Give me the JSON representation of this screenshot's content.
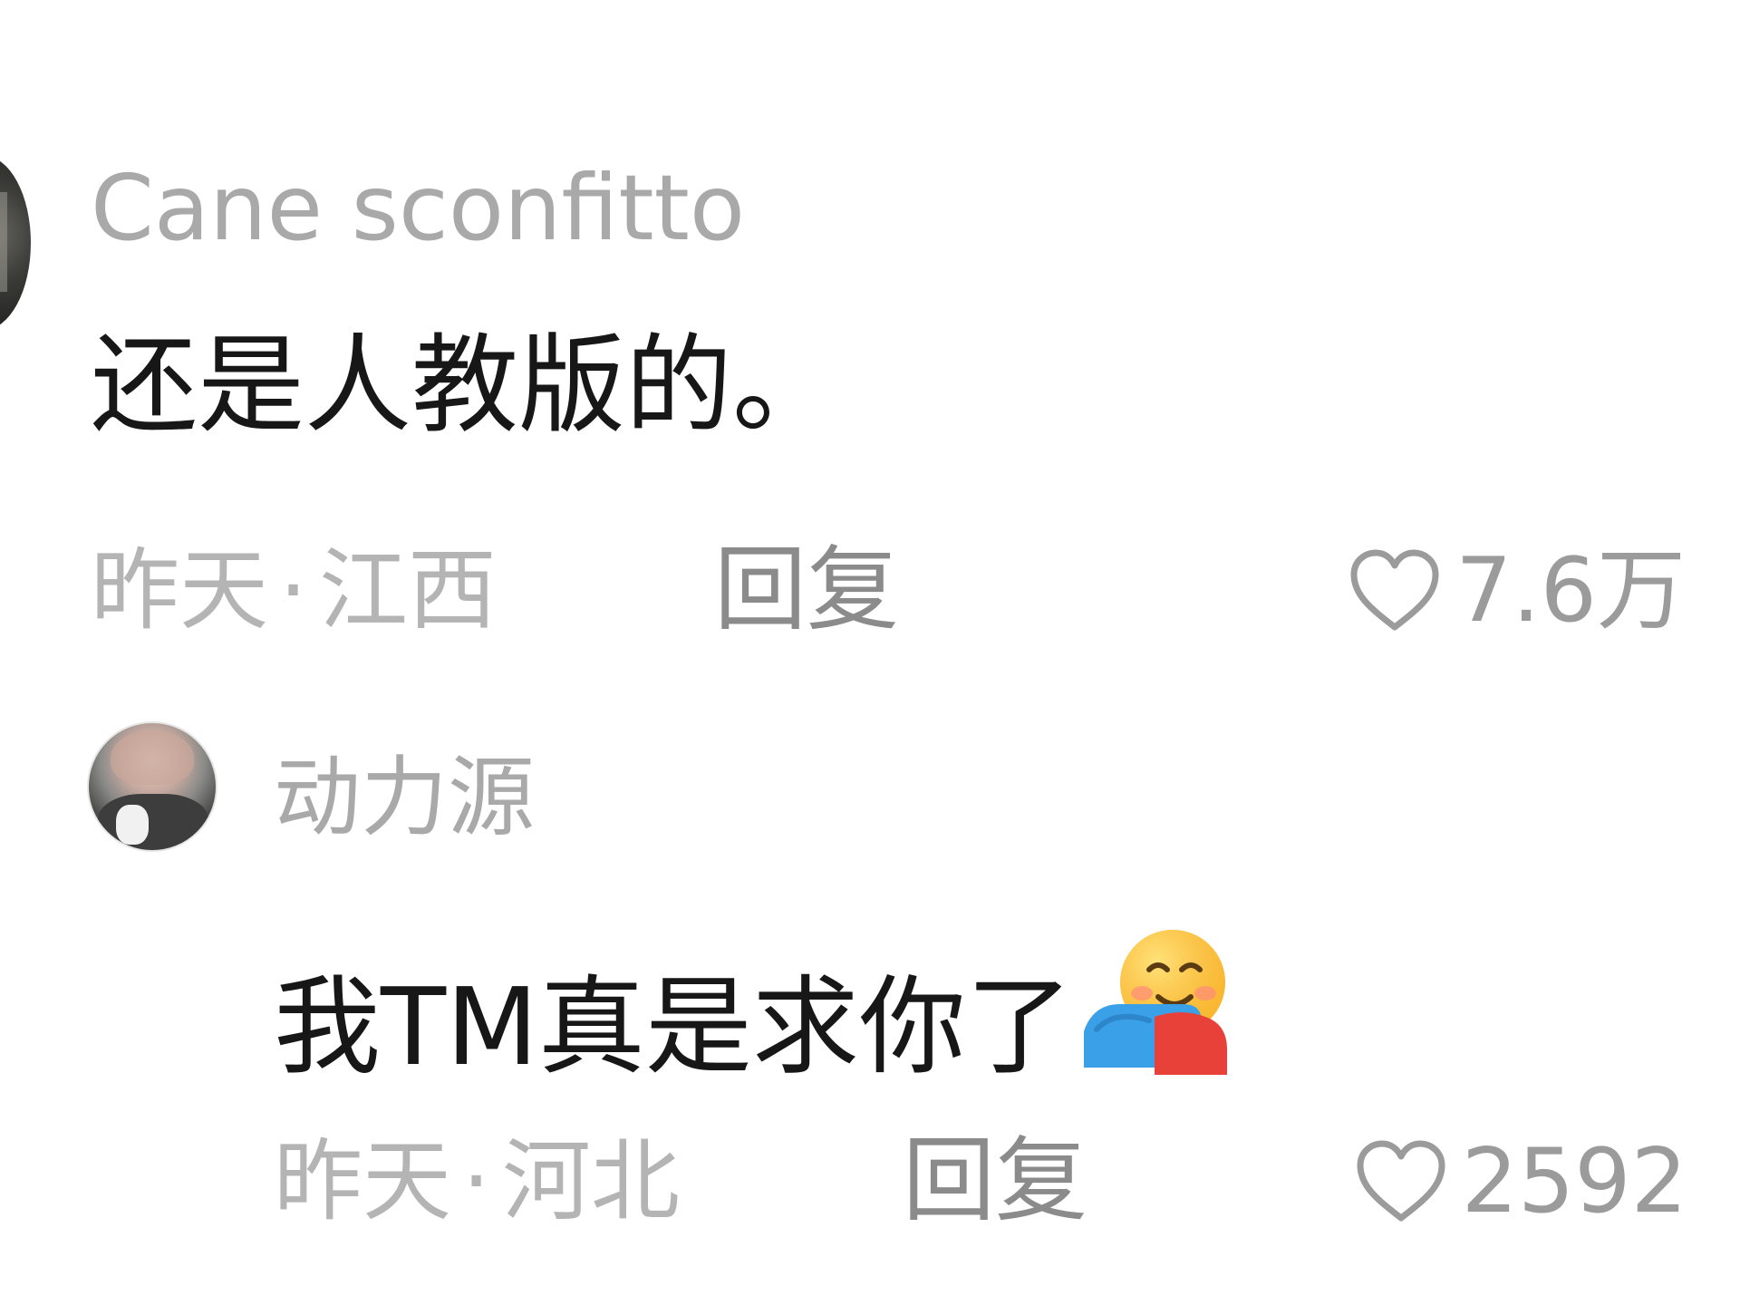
{
  "comment": {
    "author": "Cane sconfitto",
    "text": "还是人教版的。",
    "time": "昨天",
    "location": "江西",
    "reply_label": "回复",
    "likes": "7.6万"
  },
  "reply": {
    "author": "动力源",
    "text": "我TM真是求你了",
    "emoji": "hugging-face-emoji",
    "time": "昨天",
    "location": "河北",
    "reply_label": "回复",
    "likes": "2592"
  },
  "meta_separator": "·",
  "colors": {
    "author": "#a9a9a9",
    "text": "#171717",
    "meta": "#b4b4b4",
    "reply_link": "#8b8b8b",
    "like_icon": "#9b9b9b"
  }
}
